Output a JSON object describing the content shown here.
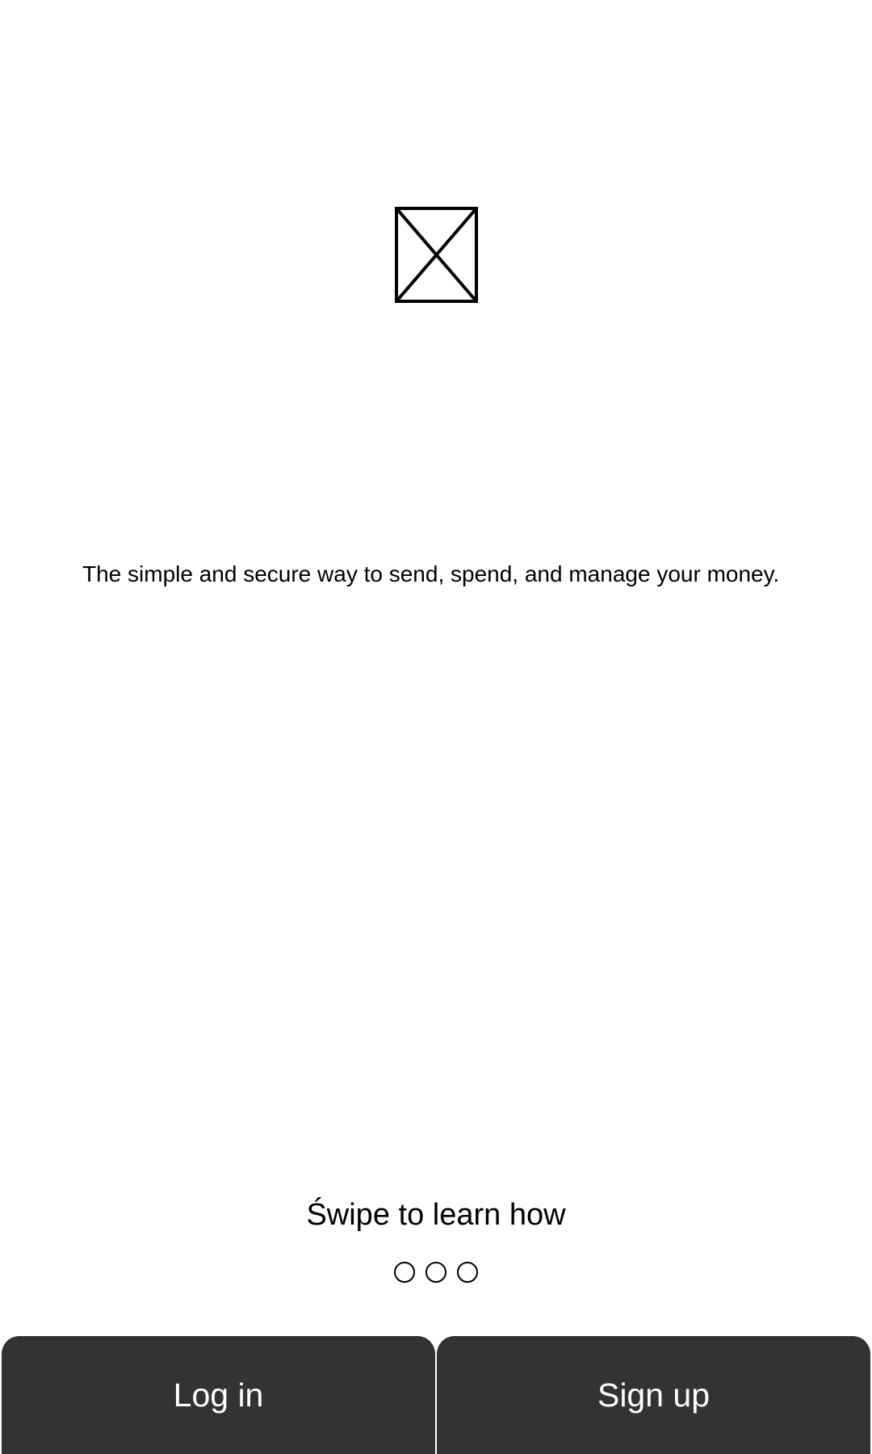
{
  "hero": {
    "image_icon": "broken-image-placeholder-icon"
  },
  "tagline": "The simple and secure way to send, spend, and manage your money.",
  "swipe_hint": "Świpe to learn how",
  "pager": {
    "pages": 3
  },
  "actions": {
    "login_label": "Log in",
    "signup_label": "Sign up"
  },
  "colors": {
    "button_bg": "#333333",
    "button_text": "#ffffff",
    "background": "#ffffff",
    "text": "#000000"
  }
}
